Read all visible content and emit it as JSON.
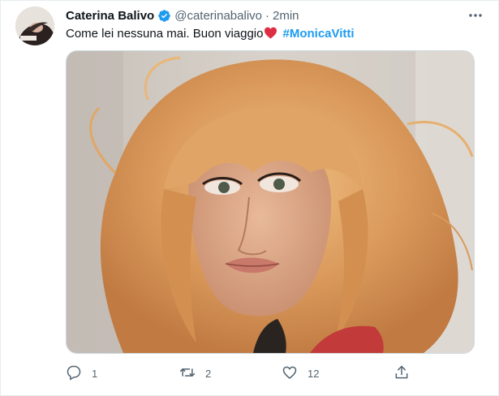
{
  "tweet": {
    "author_name": "Caterina Balivo",
    "author_handle": "@caterinabalivo",
    "separator": "·",
    "timestamp": "2min",
    "verified": true,
    "text": "Come lei nessuna mai. Buon viaggio",
    "emoji": "red-heart",
    "hashtag": "#MonicaVitti"
  },
  "actions": {
    "reply_count": "1",
    "retweet_count": "2",
    "like_count": "12"
  },
  "colors": {
    "link_blue": "#1d9bf0",
    "muted": "#536471",
    "heart_red": "#e0245e"
  },
  "icons": [
    "more-icon",
    "verified-badge-icon",
    "reply-icon",
    "retweet-icon",
    "like-icon",
    "share-icon"
  ]
}
